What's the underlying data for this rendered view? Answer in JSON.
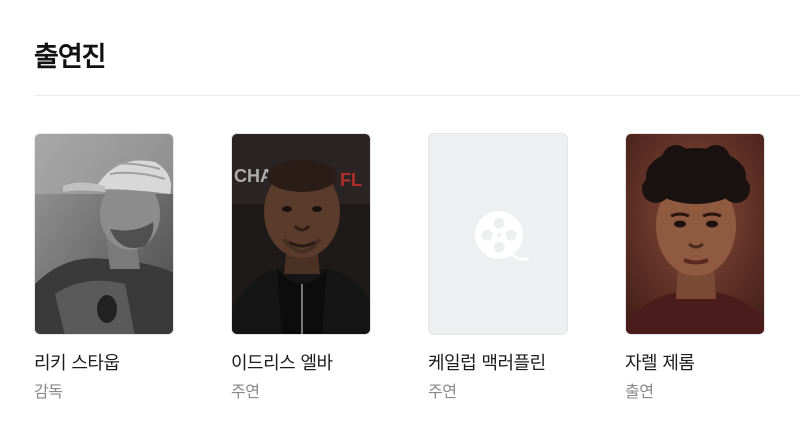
{
  "section": {
    "title": "출연진"
  },
  "cast": [
    {
      "name": "리키 스타웁",
      "role": "감독",
      "photo": "person-photo-grayscale-cap"
    },
    {
      "name": "이드리스 엘바",
      "role": "주연",
      "photo": "person-photo-dark-jacket"
    },
    {
      "name": "케일럽 맥러플린",
      "role": "주연",
      "photo": "film-reel-placeholder-icon"
    },
    {
      "name": "자렐 제롬",
      "role": "출연",
      "photo": "person-photo-portrait"
    }
  ],
  "colors": {
    "title": "#111111",
    "name": "#1c1c1c",
    "role": "#8a8a8a",
    "placeholder_bg": "#eeeff1",
    "placeholder_icon": "#ffffff"
  }
}
